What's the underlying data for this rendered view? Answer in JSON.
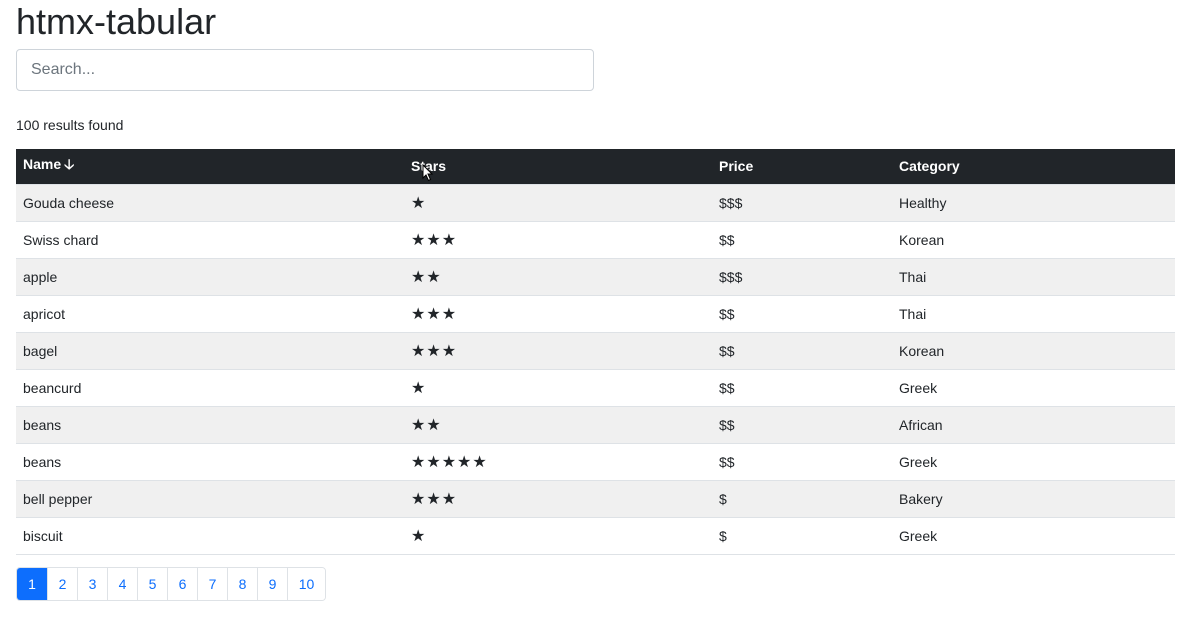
{
  "app": {
    "title": "htmx-tabular"
  },
  "search": {
    "placeholder": "Search...",
    "value": ""
  },
  "results_text": "100 results found",
  "table": {
    "headers": {
      "name": "Name",
      "sort_icon": "arrow-down-icon",
      "stars": "Stars",
      "price": "Price",
      "category": "Category"
    },
    "rows": [
      {
        "name": "Gouda cheese",
        "stars": "★",
        "price": "$$$",
        "category": "Healthy"
      },
      {
        "name": "Swiss chard",
        "stars": "★★★",
        "price": "$$",
        "category": "Korean"
      },
      {
        "name": "apple",
        "stars": "★★",
        "price": "$$$",
        "category": "Thai"
      },
      {
        "name": "apricot",
        "stars": "★★★",
        "price": "$$",
        "category": "Thai"
      },
      {
        "name": "bagel",
        "stars": "★★★",
        "price": "$$",
        "category": "Korean"
      },
      {
        "name": "beancurd",
        "stars": "★",
        "price": "$$",
        "category": "Greek"
      },
      {
        "name": "beans",
        "stars": "★★",
        "price": "$$",
        "category": "African"
      },
      {
        "name": "beans",
        "stars": "★★★★★",
        "price": "$$",
        "category": "Greek"
      },
      {
        "name": "bell pepper",
        "stars": "★★★",
        "price": "$",
        "category": "Bakery"
      },
      {
        "name": "biscuit",
        "stars": "★",
        "price": "$",
        "category": "Greek"
      }
    ]
  },
  "pagination": {
    "pages": [
      "1",
      "2",
      "3",
      "4",
      "5",
      "6",
      "7",
      "8",
      "9",
      "10"
    ],
    "active": "1"
  },
  "colors": {
    "header_bg": "#212529",
    "accent": "#0d6efd",
    "stripe": "#f0f0f0"
  }
}
